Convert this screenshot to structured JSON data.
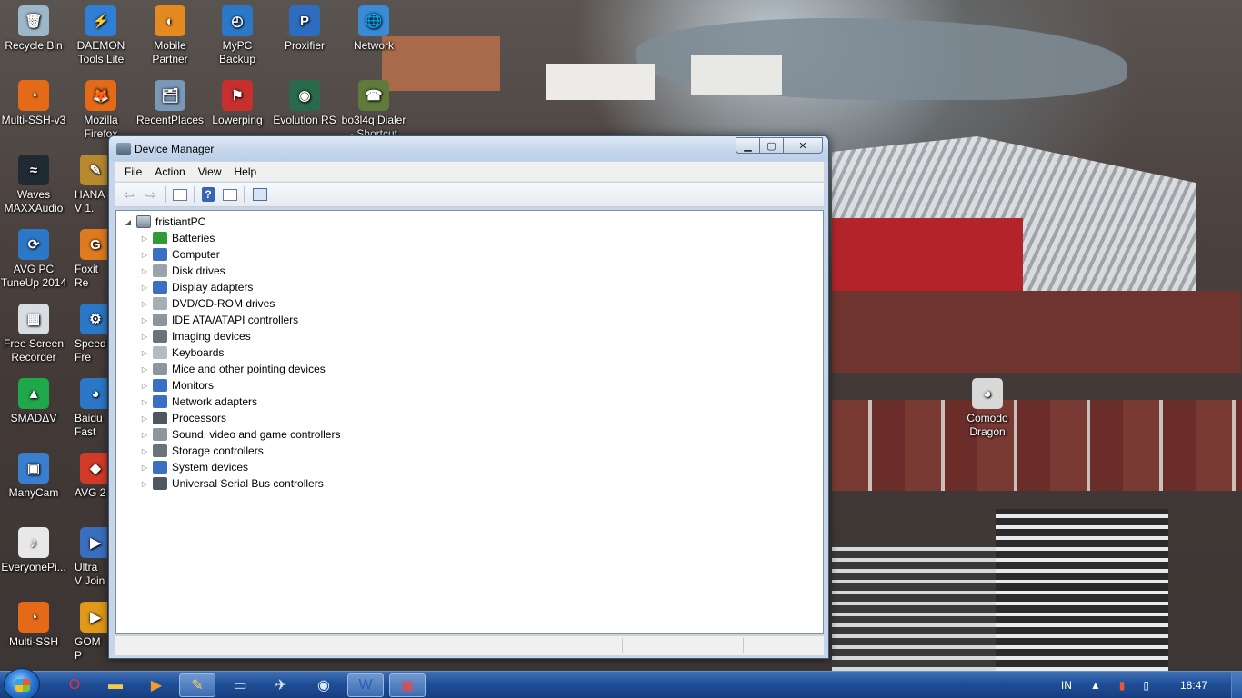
{
  "desktop": {
    "icons": [
      {
        "label": "Recycle Bin",
        "icon": "recycle-bin-icon",
        "color": "#9bb7c8",
        "glyph": "🗑"
      },
      {
        "label": "DAEMON Tools Lite",
        "icon": "daemon-tools-icon",
        "color": "#2f7fd6",
        "glyph": "⚡"
      },
      {
        "label": "Mobile Partner",
        "icon": "mobile-partner-icon",
        "color": "#e38a20",
        "glyph": "◐"
      },
      {
        "label": "MyPC Backup",
        "icon": "mypc-backup-icon",
        "color": "#2b78c8",
        "glyph": "◴"
      },
      {
        "label": "Proxifier",
        "icon": "proxifier-icon",
        "color": "#2e6cc0",
        "glyph": "P"
      },
      {
        "label": "Network",
        "icon": "network-icon",
        "color": "#3a8ad6",
        "glyph": "🌐"
      },
      {
        "label": "Multi-SSH-v3",
        "icon": "multi-ssh-v3-icon",
        "color": "#e46a17",
        "glyph": "◔"
      },
      {
        "label": "Mozilla Firefox",
        "icon": "firefox-icon",
        "color": "#e46a17",
        "glyph": "🦊"
      },
      {
        "label": "RecentPlaces",
        "icon": "recent-places-icon",
        "color": "#7a98b8",
        "glyph": "🗂"
      },
      {
        "label": "Lowerping",
        "icon": "lowerping-icon",
        "color": "#c8302e",
        "glyph": "⚑"
      },
      {
        "label": "Evolution RS",
        "icon": "evolution-rs-icon",
        "color": "#2a6a4a",
        "glyph": "◉"
      },
      {
        "label": "bo3l4q Dialer - Shortcut",
        "icon": "dialer-icon",
        "color": "#5f7a3a",
        "glyph": "☎"
      },
      {
        "label": "Waves MAXXAudio",
        "icon": "waves-maxxaudio-icon",
        "color": "#1f2a33",
        "glyph": "≈"
      },
      {
        "label": "HANA V 1.",
        "icon": "hana-icon",
        "color": "#b88a30",
        "glyph": "✎"
      },
      {
        "label": "AVG PC TuneUp 2014",
        "icon": "avg-tuneup-icon",
        "color": "#2b78c8",
        "glyph": "⟳"
      },
      {
        "label": "Foxit Re",
        "icon": "foxit-reader-icon",
        "color": "#e07a20",
        "glyph": "G"
      },
      {
        "label": "Free Screen Recorder",
        "icon": "screen-recorder-icon",
        "color": "#d7dde3",
        "glyph": "▦"
      },
      {
        "label": "Speed Fre",
        "icon": "speed-icon",
        "color": "#2b78c8",
        "glyph": "⚙"
      },
      {
        "label": "SMADΔV",
        "icon": "smadav-icon",
        "color": "#1fa84a",
        "glyph": "▲"
      },
      {
        "label": "Baidu Fast",
        "icon": "baidu-icon",
        "color": "#2b78c8",
        "glyph": "◕"
      },
      {
        "label": "ManyCam",
        "icon": "manycam-icon",
        "color": "#3a7fcf",
        "glyph": "▣"
      },
      {
        "label": "AVG 2",
        "icon": "avg-icon",
        "color": "#d23b2a",
        "glyph": "◆"
      },
      {
        "label": "EveryonePi...",
        "icon": "everyonepiano-icon",
        "color": "#e8e8e8",
        "glyph": "♪"
      },
      {
        "label": "Ultra V Join",
        "icon": "ultra-video-joiner-icon",
        "color": "#3a6fc0",
        "glyph": "▶"
      },
      {
        "label": "Multi-SSH",
        "icon": "multi-ssh-icon",
        "color": "#e46a17",
        "glyph": "◔"
      },
      {
        "label": "GOM P",
        "icon": "gom-player-icon",
        "color": "#e09a1a",
        "glyph": "▶"
      },
      {
        "label": "Comodo Dragon",
        "icon": "comodo-dragon-icon",
        "color": "#d8d8d8",
        "glyph": "◕"
      }
    ]
  },
  "window": {
    "title": "Device Manager",
    "menu": [
      "File",
      "Action",
      "View",
      "Help"
    ],
    "toolbar": [
      {
        "icon": "back-arrow-icon"
      },
      {
        "icon": "forward-arrow-icon"
      },
      {
        "icon": "show-hide-console-tree-icon"
      },
      {
        "icon": "help-icon"
      },
      {
        "icon": "properties-icon"
      },
      {
        "icon": "scan-hardware-changes-icon"
      }
    ],
    "root": "fristiantPC",
    "categories": [
      {
        "label": "Batteries",
        "icon": "battery-icon",
        "color": "#2f9a3a"
      },
      {
        "label": "Computer",
        "icon": "computer-icon",
        "color": "#3b6fc4"
      },
      {
        "label": "Disk drives",
        "icon": "disk-drive-icon",
        "color": "#9aa3ab"
      },
      {
        "label": "Display adapters",
        "icon": "display-adapter-icon",
        "color": "#3b6fc4"
      },
      {
        "label": "DVD/CD-ROM drives",
        "icon": "dvd-drive-icon",
        "color": "#a6adb4"
      },
      {
        "label": "IDE ATA/ATAPI controllers",
        "icon": "ide-controller-icon",
        "color": "#8d969e"
      },
      {
        "label": "Imaging devices",
        "icon": "camera-icon",
        "color": "#6a737c"
      },
      {
        "label": "Keyboards",
        "icon": "keyboard-icon",
        "color": "#b4bbc2"
      },
      {
        "label": "Mice and other pointing devices",
        "icon": "mouse-icon",
        "color": "#8d969e"
      },
      {
        "label": "Monitors",
        "icon": "monitor-icon",
        "color": "#3b6fc4"
      },
      {
        "label": "Network adapters",
        "icon": "network-adapter-icon",
        "color": "#3b6fc4"
      },
      {
        "label": "Processors",
        "icon": "processor-icon",
        "color": "#4f575e"
      },
      {
        "label": "Sound, video and game controllers",
        "icon": "speaker-icon",
        "color": "#8d969e"
      },
      {
        "label": "Storage controllers",
        "icon": "storage-controller-icon",
        "color": "#6a737c"
      },
      {
        "label": "System devices",
        "icon": "system-devices-icon",
        "color": "#3b6fc4"
      },
      {
        "label": "Universal Serial Bus controllers",
        "icon": "usb-icon",
        "color": "#4f575e"
      }
    ]
  },
  "taskbar": {
    "apps": [
      {
        "icon": "opera-icon",
        "glyph": "O",
        "color": "#e8322b"
      },
      {
        "icon": "explorer-folder-icon",
        "glyph": "▬",
        "color": "#f2c94c"
      },
      {
        "icon": "media-player-icon",
        "glyph": "▶",
        "color": "#f29b2c"
      },
      {
        "icon": "pen-tool-icon",
        "glyph": "✎",
        "color": "#f2d36c"
      },
      {
        "icon": "window-app-icon",
        "glyph": "▭",
        "color": "#d8e6f5"
      },
      {
        "icon": "network-tool-icon",
        "glyph": "✈",
        "color": "#d8e6f5"
      },
      {
        "icon": "game-icon",
        "glyph": "◉",
        "color": "#d8e6f5"
      },
      {
        "icon": "word-icon",
        "glyph": "W",
        "color": "#2b5fb4"
      },
      {
        "icon": "device-manager-task-icon",
        "glyph": "▣",
        "color": "#e04c4c"
      }
    ],
    "language": "IN",
    "clock": "18:47"
  }
}
